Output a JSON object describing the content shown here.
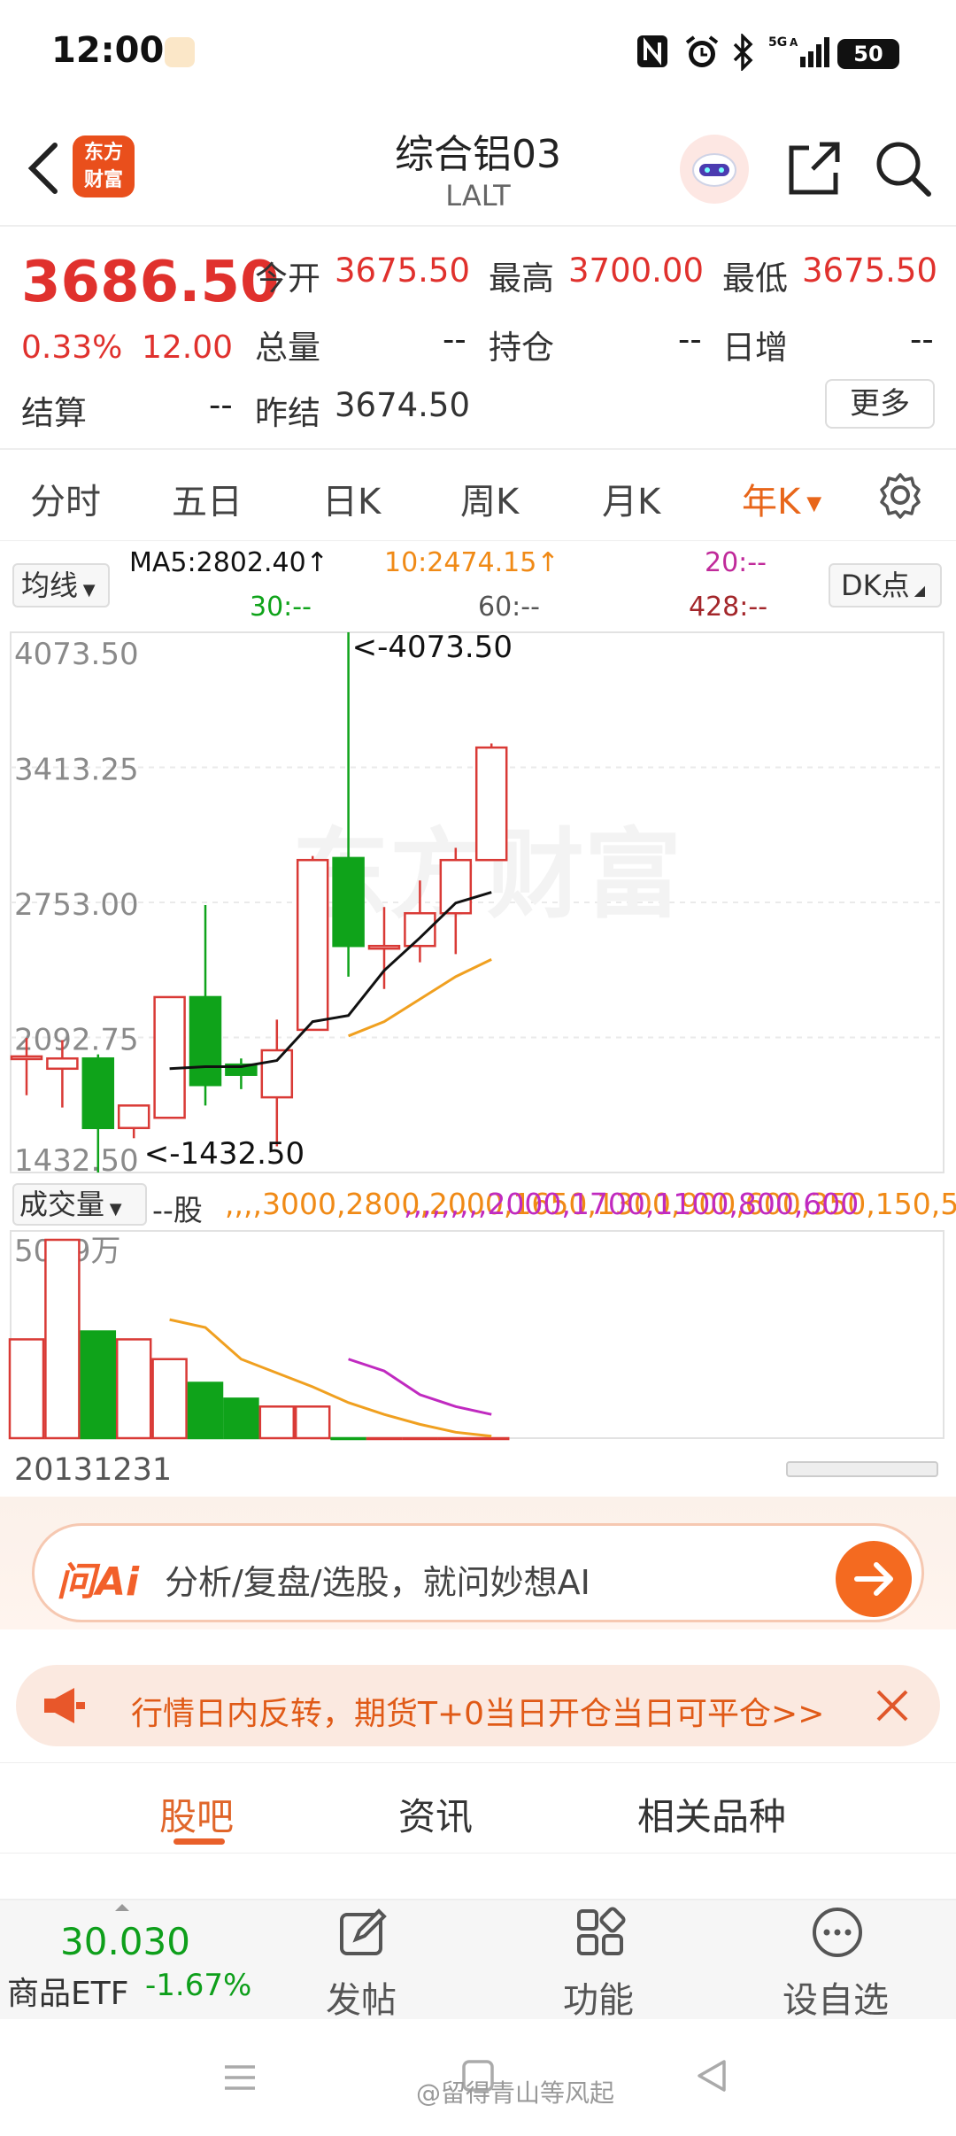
{
  "status_bar": {
    "time": "12:00",
    "network": "5G",
    "battery": "50"
  },
  "header": {
    "title": "综合铝03",
    "subtitle": "LALT",
    "logo_text_1": "东方",
    "logo_text_2": "财富"
  },
  "quote": {
    "price": "3686.50",
    "change_pct": "0.33%",
    "change": "12.00",
    "open_label": "今开",
    "open": "3675.50",
    "high_label": "最高",
    "high": "3700.00",
    "low_label": "最低",
    "low": "3675.50",
    "volume_label": "总量",
    "volume": "--",
    "position_label": "持仓",
    "position": "--",
    "daily_inc_label": "日增",
    "daily_inc": "--",
    "settle_label": "结算",
    "settle": "--",
    "prev_settle_label": "昨结",
    "prev_settle": "3674.50",
    "more_label": "更多"
  },
  "period_tabs": [
    "分时",
    "五日",
    "日K",
    "周K",
    "月K",
    "年K"
  ],
  "ma_row": {
    "button": "均线",
    "ma5": "MA5:2802.40↑",
    "ma10": "10:2474.15↑",
    "ma20": "20:--",
    "ma30": "30:--",
    "ma60": "60:--",
    "ma428": "428:--",
    "dk_button": "DK点"
  },
  "colors": {
    "up": "#d93a36",
    "down": "#0fa31a",
    "ma5": "#111111",
    "ma10": "#f0a020",
    "ma_pink": "#c02a9a",
    "accent": "#f46a20"
  },
  "chart_data": {
    "type": "candlestick",
    "y_ticks": [
      "4073.50",
      "3413.25",
      "2753.00",
      "2092.75",
      "1432.50"
    ],
    "ylim": [
      1432.5,
      4073.5
    ],
    "max_label": "<-4073.50",
    "min_label": "<-1432.50",
    "watermark": "东方财富",
    "candles": [
      {
        "open": 2000,
        "close": 2000,
        "high": 2090,
        "low": 1810
      },
      {
        "open": 1940,
        "close": 1990,
        "high": 2080,
        "low": 1750
      },
      {
        "open": 1990,
        "close": 1650,
        "high": 2010,
        "low": 1432.5
      },
      {
        "open": 1650,
        "close": 1760,
        "high": 1760,
        "low": 1600
      },
      {
        "open": 1700,
        "close": 2290,
        "high": 2290,
        "low": 1700
      },
      {
        "open": 2290,
        "close": 1860,
        "high": 2740,
        "low": 1760
      },
      {
        "open": 1960,
        "close": 1910,
        "high": 1990,
        "low": 1840
      },
      {
        "open": 1800,
        "close": 2030,
        "high": 2180,
        "low": 1560
      },
      {
        "open": 2130,
        "close": 2960,
        "high": 2980,
        "low": 2130
      },
      {
        "open": 2970,
        "close": 2540,
        "high": 4073.5,
        "low": 2390
      },
      {
        "open": 2540,
        "close": 2540,
        "high": 2730,
        "low": 2330
      },
      {
        "open": 2540,
        "close": 2700,
        "high": 2860,
        "low": 2460
      },
      {
        "open": 2700,
        "close": 2960,
        "high": 3020,
        "low": 2500
      },
      {
        "open": 2960,
        "close": 3510,
        "high": 3530,
        "low": 2960
      }
    ],
    "ma5": [
      null,
      null,
      null,
      null,
      1940,
      1950,
      1950,
      1980,
      2170,
      2200,
      2420,
      2580,
      2750,
      2802.4
    ],
    "ma10": [
      null,
      null,
      null,
      null,
      null,
      null,
      null,
      null,
      null,
      2100,
      2170,
      2280,
      2390,
      2474.15
    ]
  },
  "volume": {
    "button": "成交量",
    "vol_label": "--股",
    "ma1": [
      null,
      null,
      null,
      null,
      3000,
      2800,
      2000,
      1650,
      1300,
      900,
      600,
      350,
      150,
      50
    ],
    "ma2": [
      null,
      null,
      null,
      null,
      null,
      null,
      null,
      null,
      null,
      2000,
      1700,
      1100,
      800,
      600
    ],
    "max_label": "5019万",
    "date": "20131231",
    "bars": [
      2500,
      5019,
      2700,
      2500,
      2000,
      1400,
      1000,
      800,
      800,
      0,
      0,
      0,
      0,
      0
    ]
  },
  "ai_bar": {
    "logo": "问Ai",
    "text": "分析/复盘/选股，就问妙想AI"
  },
  "notice": {
    "text": "行情日内反转，期货T+0当日开仓当日可平仓>>"
  },
  "community_tabs": [
    "股吧",
    "资讯",
    "相关品种"
  ],
  "bottom_bar": {
    "etf_price": "30.030",
    "etf_name": "商品ETF",
    "etf_pct": "-1.67%",
    "post": "发帖",
    "functions": "功能",
    "watchlist": "设自选"
  },
  "watermark": "@留得青山等风起"
}
